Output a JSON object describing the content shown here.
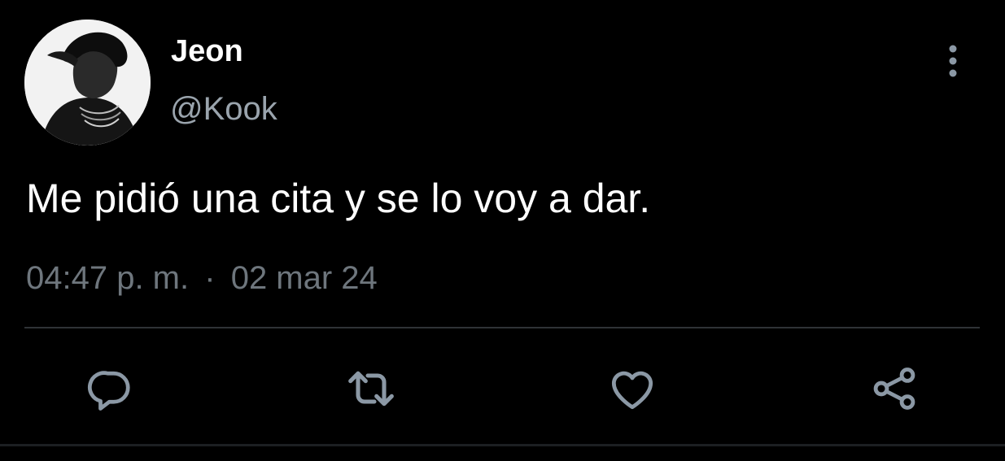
{
  "user": {
    "display_name": "Jeon",
    "handle": "@Kook",
    "avatar_icon": "profile-photo"
  },
  "tweet": {
    "text": "Me pidió una cita y se lo voy a dar.",
    "time": "04:47 p. m.",
    "separator": "·",
    "date": "02 mar 24"
  },
  "actions": [
    {
      "name": "reply",
      "icon": "speech-bubble-icon"
    },
    {
      "name": "retweet",
      "icon": "retweet-arrows-icon"
    },
    {
      "name": "like",
      "icon": "heart-icon"
    },
    {
      "name": "share",
      "icon": "share-nodes-icon"
    }
  ],
  "colors": {
    "background": "#000000",
    "primary_text": "#ffffff",
    "secondary_text": "#6e767d",
    "icon": "#8b98a5",
    "divider": "#2f3336"
  }
}
